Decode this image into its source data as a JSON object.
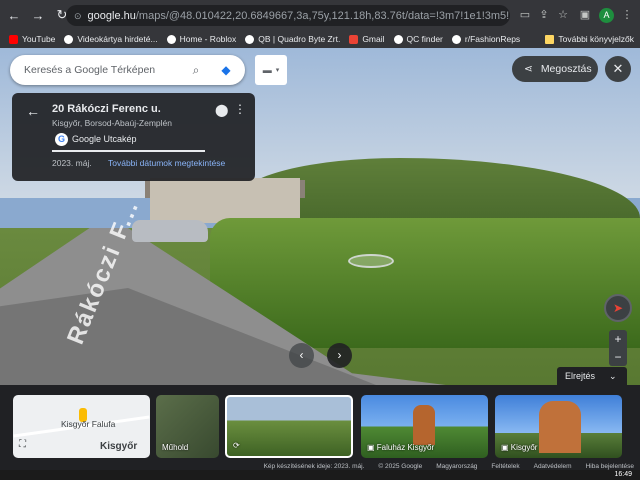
{
  "browser": {
    "url_host": "google.hu",
    "url_path": "/maps/@48.010422,20.6849667,3a,75y,121.18h,83.76t/data=!3m7!1e1!3m5!1sh0uLGdasRfToWYQ...",
    "avatar_letter": "A",
    "bookmarks": [
      {
        "label": "YouTube",
        "color": "#ff0000"
      },
      {
        "label": "Videokártya hirdeté...",
        "color": "#ffffff"
      },
      {
        "label": "Home - Roblox",
        "color": "#ffffff"
      },
      {
        "label": "QB | Quadro Byte Zrt.",
        "color": "#ffffff"
      },
      {
        "label": "Gmail",
        "color": "#ea4335"
      },
      {
        "label": "QC finder",
        "color": "#ffffff"
      },
      {
        "label": "r/FashionReps",
        "color": "#ffffff"
      }
    ],
    "other_bookmarks": "További könyvjelzők"
  },
  "maps": {
    "search_placeholder": "Keresés a Google Térképen",
    "share_label": "Megosztás",
    "close_icon": "close-icon"
  },
  "info_card": {
    "title": "20 Rákóczi Ferenc u.",
    "subtitle": "Kisgyőr, Borsod-Abaúj-Zemplén",
    "source": "Google Utcakép",
    "date": "2023. máj.",
    "more_dates": "További dátumok megtekintése"
  },
  "street_text": "Rákóczi F...",
  "controls": {
    "hide_label": "Elrejtés",
    "zoom_in": "+",
    "zoom_out": "−"
  },
  "filmstrip": {
    "map_town": "Kisgyőr Falufa",
    "map_big": "Kisgyőr",
    "satellite": "Műhold",
    "photo1": "Faluház Kisgyőr",
    "photo2": "Kisgyőr"
  },
  "credits": {
    "capture": "Kép készítésének ideje: 2023. máj.",
    "copyright": "© 2025 Google",
    "country": "Magyarország",
    "terms": "Feltételek",
    "privacy": "Adatvédelem",
    "report": "Hiba bejelentése"
  },
  "taskbar": {
    "clock": "16:49"
  }
}
